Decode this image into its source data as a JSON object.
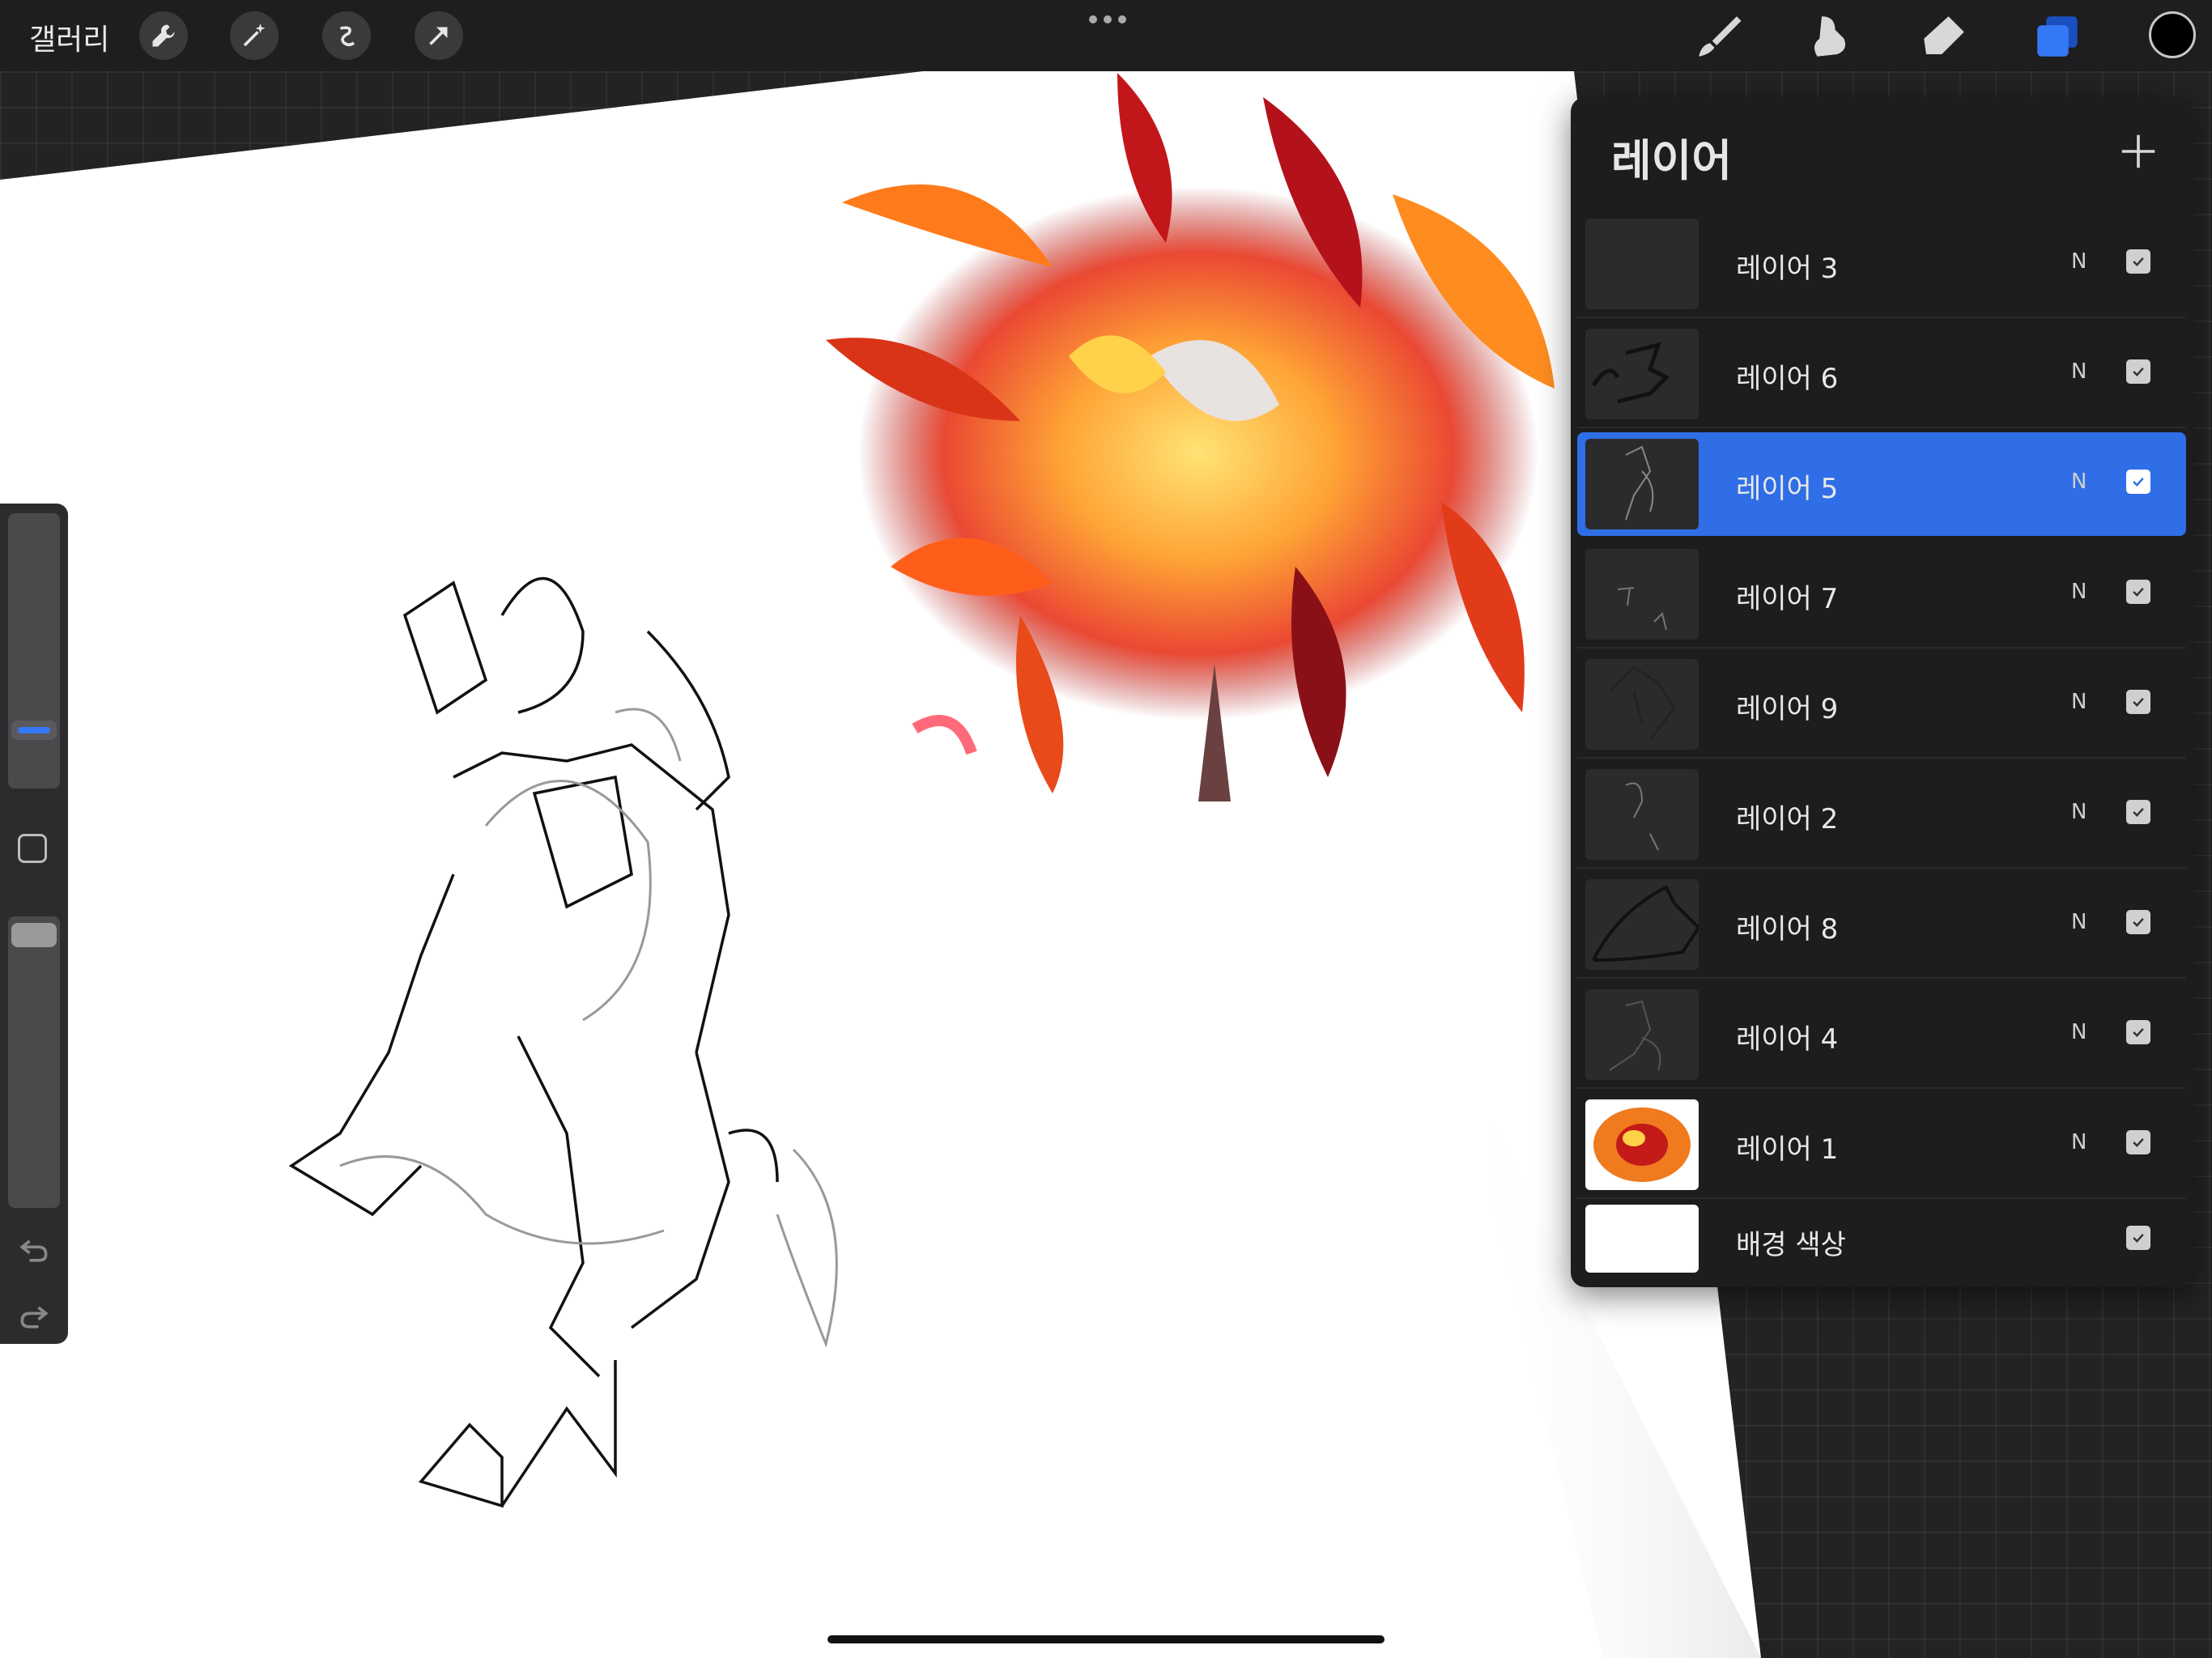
{
  "topbar": {
    "gallery_label": "갤러리",
    "tools": [
      "wrench-icon",
      "magic-wand-icon",
      "selection-icon",
      "transform-arrow-icon"
    ],
    "right_tools": [
      "brush-icon",
      "smudge-icon",
      "eraser-icon",
      "layers-icon"
    ],
    "current_color": "#000000",
    "accent_color": "#3478f6"
  },
  "layers_panel": {
    "title": "레이어",
    "layers": [
      {
        "name": "레이어 3",
        "mode": "N",
        "visible": true,
        "active": false
      },
      {
        "name": "레이어 6",
        "mode": "N",
        "visible": true,
        "active": false
      },
      {
        "name": "레이어 5",
        "mode": "N",
        "visible": true,
        "active": true
      },
      {
        "name": "레이어 7",
        "mode": "N",
        "visible": true,
        "active": false
      },
      {
        "name": "레이어 9",
        "mode": "N",
        "visible": true,
        "active": false
      },
      {
        "name": "레이어 2",
        "mode": "N",
        "visible": true,
        "active": false
      },
      {
        "name": "레이어 8",
        "mode": "N",
        "visible": true,
        "active": false
      },
      {
        "name": "레이어 4",
        "mode": "N",
        "visible": true,
        "active": false
      },
      {
        "name": "레이어 1",
        "mode": "N",
        "visible": true,
        "active": false
      }
    ],
    "background": {
      "name": "배경 색상",
      "visible": true
    }
  }
}
